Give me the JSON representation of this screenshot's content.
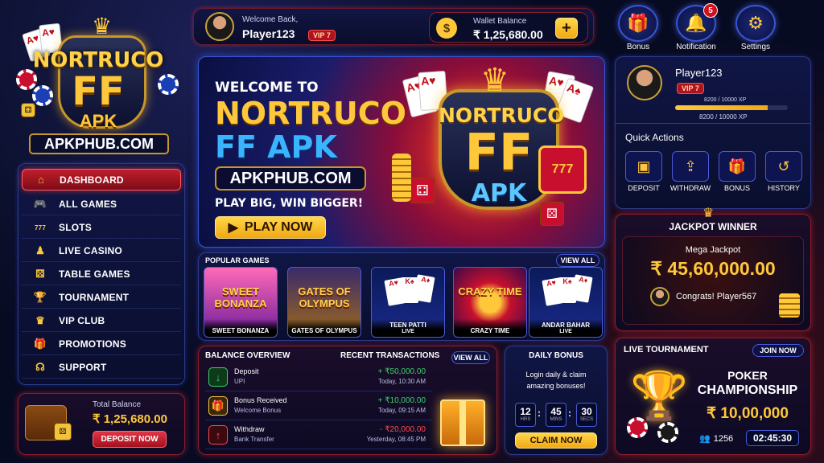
{
  "brand": {
    "name_line1": "NORTRUCO",
    "name_line2": "FF",
    "name_line3": "APK",
    "url": "APKPHUB.COM"
  },
  "sidebar": {
    "items": [
      {
        "label": "DASHBOARD",
        "icon": "home-icon",
        "glyph": "⌂",
        "active": true
      },
      {
        "label": "ALL GAMES",
        "icon": "gamepad-icon",
        "glyph": "🎮"
      },
      {
        "label": "SLOTS",
        "icon": "slots-icon",
        "glyph": "777"
      },
      {
        "label": "LIVE CASINO",
        "icon": "dealer-icon",
        "glyph": "♟"
      },
      {
        "label": "TABLE GAMES",
        "icon": "dice-icon",
        "glyph": "⚄"
      },
      {
        "label": "TOURNAMENT",
        "icon": "trophy-icon",
        "glyph": "🏆"
      },
      {
        "label": "VIP CLUB",
        "icon": "crown-icon",
        "glyph": "♛"
      },
      {
        "label": "PROMOTIONS",
        "icon": "gift-icon",
        "glyph": "🎁"
      },
      {
        "label": "SUPPORT",
        "icon": "headset-icon",
        "glyph": "☊"
      }
    ]
  },
  "total_balance": {
    "label": "Total Balance",
    "amount": "₹ 1,25,680.00",
    "button": "DEPOSIT NOW"
  },
  "header": {
    "welcome": "Welcome Back,",
    "username": "Player123",
    "vip": "VIP 7",
    "wallet_label": "Wallet Balance",
    "wallet_amount": "₹ 1,25,680.00",
    "add_glyph": "+"
  },
  "top_actions": [
    {
      "label": "Bonus",
      "icon": "gift-icon",
      "glyph": "🎁"
    },
    {
      "label": "Notification",
      "icon": "bell-icon",
      "glyph": "🔔",
      "badge": "5"
    },
    {
      "label": "Settings",
      "icon": "gear-icon",
      "glyph": "⚙"
    }
  ],
  "hero": {
    "welcome": "WELCOME TO",
    "title1": "NORTRUCO",
    "title2": "FF APK",
    "url": "APKPHUB.COM",
    "tagline": "PLAY BIG, WIN BIGGER!",
    "cta": "PLAY NOW",
    "logo_line1": "NORTRUCO",
    "logo_line2": "FF",
    "logo_line3": "APK"
  },
  "popular": {
    "title": "POPULAR GAMES",
    "view_all": "VIEW ALL",
    "games": [
      {
        "name": "SWEET BONANZA",
        "art": "SWEET BONANZA",
        "sub": ""
      },
      {
        "name": "GATES OF OLYMPUS",
        "art": "GATES OF OLYMPUS",
        "sub": ""
      },
      {
        "name": "TEEN PATTI",
        "art": "",
        "sub": "LIVE"
      },
      {
        "name": "CRAZY TIME",
        "art": "CRAZY TIME",
        "sub": ""
      },
      {
        "name": "ANDAR BAHAR",
        "art": "",
        "sub": "LIVE"
      }
    ]
  },
  "balance_overview": {
    "title": "BALANCE OVERVIEW",
    "recent": "RECENT TRANSACTIONS",
    "view_all": "VIEW ALL",
    "transactions": [
      {
        "title": "Deposit",
        "sub": "UPI",
        "amount": "+ ₹50,000.00",
        "time": "Today, 10:30 AM",
        "type": "in"
      },
      {
        "title": "Bonus Received",
        "sub": "Welcome Bonus",
        "amount": "+ ₹10,000.00",
        "time": "Today, 09:15 AM",
        "type": "bonus"
      },
      {
        "title": "Withdraw",
        "sub": "Bank Transfer",
        "amount": "- ₹20,000.00",
        "time": "Yesterday, 08:45 PM",
        "type": "out"
      }
    ]
  },
  "daily_bonus": {
    "title": "DAILY BONUS",
    "text1": "Login daily & claim",
    "text2": "amazing bonuses!",
    "hrs": "12",
    "mins": "45",
    "secs": "30",
    "hrs_lbl": "HRS",
    "mins_lbl": "MINS",
    "secs_lbl": "SECS",
    "button": "CLAIM NOW"
  },
  "profile": {
    "username": "Player123",
    "vip": "VIP 7",
    "xp1": "8200 / 10000 XP",
    "xp2": "8200 / 10000 XP",
    "xp_fraction": 0.82,
    "quick_actions_title": "Quick Actions",
    "actions": [
      {
        "label": "DEPOSIT",
        "icon": "wallet-icon",
        "glyph": "▣"
      },
      {
        "label": "WITHDRAW",
        "icon": "upload-icon",
        "glyph": "⇪"
      },
      {
        "label": "BONUS",
        "icon": "gift-icon",
        "glyph": "🎁"
      },
      {
        "label": "HISTORY",
        "icon": "history-icon",
        "glyph": "↺"
      }
    ]
  },
  "jackpot": {
    "title": "JACKPOT WINNER",
    "label": "Mega Jackpot",
    "amount": "₹ 45,60,000.00",
    "congrats": "Congrats! Player567"
  },
  "tournament": {
    "title": "LIVE TOURNAMENT",
    "join": "JOIN NOW",
    "name1": "POKER",
    "name2": "CHAMPIONSHIP",
    "prize": "₹ 10,00,000",
    "players": "1256",
    "timer": "02:45:30"
  },
  "colors": {
    "accent_gold": "#ffc83a",
    "accent_red": "#c11e2c",
    "bg": "#070b22",
    "panel_border": "#2d3a8a",
    "green": "#3ad06a"
  }
}
